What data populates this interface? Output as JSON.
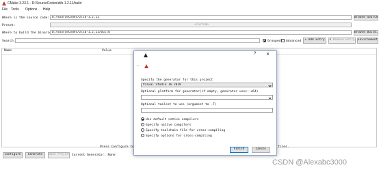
{
  "window": {
    "title": "CMake 3.23.1 - D:/SourceCodes/zlib-1.2.11/build"
  },
  "menu": [
    "File",
    "Tools",
    "Options",
    "Help"
  ],
  "source": {
    "label": "Where is the source code:",
    "value": "D:/SourceCodes/zlib-1.2.11",
    "button": "Browse Source..."
  },
  "preset": {
    "label": "Preset:",
    "value": "<custom>"
  },
  "build": {
    "label": "Where to build the binaries:",
    "value": "D:/SourceCodes/zlib-1.2.11/build",
    "button": "Browse Build..."
  },
  "search": {
    "label": "Search:",
    "grouped": "Grouped",
    "advanced": "Advanced",
    "add_entry": "Add Entry",
    "remove_entry": "Remove Entry",
    "environment": "Environment..."
  },
  "table": {
    "col_name": "Name",
    "col_value": "Value"
  },
  "status": {
    "message_left": "Press Configure to",
    "message_right": "files.",
    "configure": "Configure",
    "generate": "Generate",
    "open_project": "Open Project",
    "current_generator": "Current Generator: None"
  },
  "dialog": {
    "help_glyph": "?",
    "close_glyph": "✕",
    "back_glyph": "←",
    "specify_label": "Specify the generator for this project",
    "generator": "Visual Studio 16 2019",
    "platform_label": "Optional platform for generator(if empty, generator uses: x64)",
    "toolset_label": "Optional toolset to use (argument to -T)",
    "options": [
      "Use default native compilers",
      "Specify native compilers",
      "Specify toolchain file for cross-compiling",
      "Specify options for cross-compiling"
    ],
    "finish": "Finish",
    "cancel": "Cancel"
  },
  "watermark": "CSDN @Alexabc3000",
  "colors": {
    "accent": "#0078d7",
    "warning_icon": "#c0392b"
  }
}
